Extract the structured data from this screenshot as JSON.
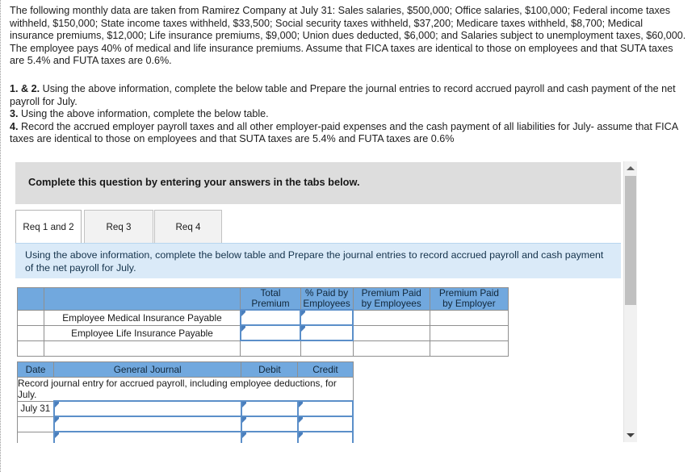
{
  "problem": {
    "statement": "The following monthly data are taken from Ramirez Company at July 31: Sales salaries, $500,000; Office salaries, $100,000; Federal income taxes withheld, $150,000; State income taxes withheld, $33,500; Social security taxes withheld, $37,200; Medicare taxes withheld, $8,700; Medical insurance premiums, $12,000; Life insurance premiums, $9,000; Union dues deducted, $6,000; and Salaries subject to unemployment taxes, $60,000. The employee pays 40% of medical and life insurance premiums. Assume that FICA taxes are identical to those on employees and that SUTA taxes are 5.4% and FUTA taxes are 0.6%."
  },
  "requirements": [
    {
      "number": "1. & 2.",
      "text": " Using the above information, complete the below table and Prepare the journal entries to record accrued payroll and cash payment of the net payroll for July."
    },
    {
      "number": "3.",
      "text": " Using the above information, complete the below table."
    },
    {
      "number": "4.",
      "text": " Record the accrued employer payroll taxes and all other employer-paid expenses and the cash payment of all liabilities for July- assume that FICA taxes are identical to those on employees and that SUTA taxes are 5.4% and FUTA taxes are 0.6%"
    }
  ],
  "widget": {
    "banner": "Complete this question by entering your answers in the tabs below.",
    "tabs": [
      {
        "label": "Req 1 and 2",
        "active": true
      },
      {
        "label": "Req 3",
        "active": false
      },
      {
        "label": "Req 4",
        "active": false
      }
    ],
    "instruction": "Using the above information, complete the below table and Prepare the journal entries to record accrued payroll and cash payment of the net payroll for July."
  },
  "premium_table": {
    "headers": [
      "",
      "",
      "Total Premium",
      "% Paid by Employees",
      "Premium Paid by Employees",
      "Premium Paid by Employer"
    ],
    "header_lines": {
      "total_premium": [
        "Total",
        "Premium"
      ],
      "pct_paid": [
        "% Paid by",
        "Employees"
      ],
      "paid_employees": [
        "Premium Paid",
        "by Employees"
      ],
      "paid_employer": [
        "Premium Paid",
        "by Employer"
      ]
    },
    "rows": [
      {
        "label": "Employee Medical Insurance Payable",
        "total_premium": "",
        "pct_paid": "",
        "paid_employees": "",
        "paid_employer": ""
      },
      {
        "label": "Employee Life Insurance Payable",
        "total_premium": "",
        "pct_paid": "",
        "paid_employees": "",
        "paid_employer": ""
      }
    ]
  },
  "journal_table": {
    "headers": [
      "Date",
      "General Journal",
      "Debit",
      "Credit"
    ],
    "note": "Record journal entry for accrued payroll, including employee deductions, for July.",
    "rows": [
      {
        "date": "July 31",
        "account": "",
        "debit": "",
        "credit": ""
      },
      {
        "date": "",
        "account": "",
        "debit": "",
        "credit": ""
      },
      {
        "date": "",
        "account": "",
        "debit": "",
        "credit": ""
      }
    ]
  },
  "scrollbar": {
    "up_arrow": "scroll-up",
    "down_arrow": "scroll-down"
  },
  "colors": {
    "header_blue": "#71a8de",
    "instruction_blue": "#daeaf8",
    "banner_grey": "#dddddd",
    "input_border": "#5b8fc9"
  }
}
